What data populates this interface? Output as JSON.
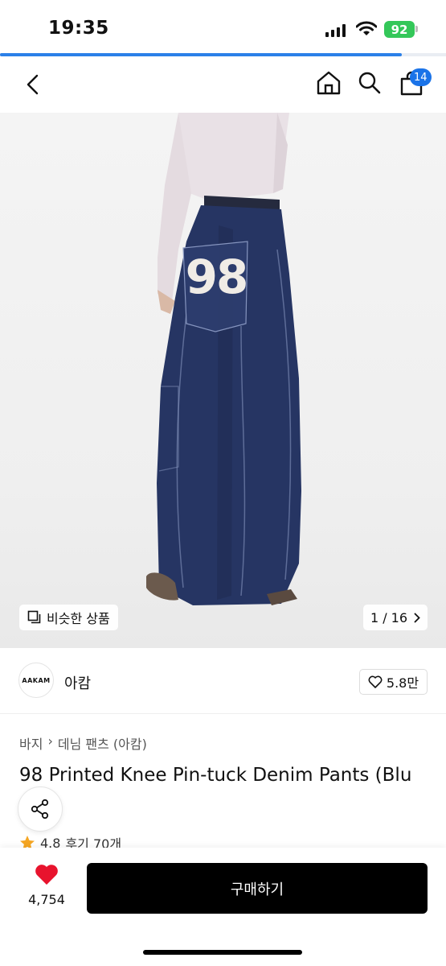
{
  "status_bar": {
    "time": "19:35",
    "battery": "92",
    "icons": [
      "signal-icon",
      "wifi-icon",
      "battery-icon"
    ],
    "battery_color": "#34c759"
  },
  "page_loading": {
    "progress_percent": 90,
    "color": "#2b80e8"
  },
  "nav": {
    "icons": [
      "chevron-left-icon",
      "home-icon",
      "search-icon",
      "shopping-bag-icon"
    ],
    "cart_badge": "14",
    "badge_color": "#1a73e8"
  },
  "hero": {
    "similar_label": "비슷한 상품",
    "similar_icon": "copy-icon",
    "page_indicator": "1 / 16",
    "pocket_print": "98"
  },
  "brand": {
    "logo_text": "AAKAM",
    "name": "아캄",
    "likes": "5.8만",
    "like_icon": "heart-outline-icon"
  },
  "product": {
    "breadcrumb": [
      "바지",
      "데님 팬츠 (아캄)"
    ],
    "title": "98 Printed Knee Pin-tuck Denim Pants (Blu",
    "rating": "4.8",
    "reviews": "후기 70개",
    "star_color": "#f5a623"
  },
  "bottom_bar": {
    "wish_count": "4,754",
    "wish_icon": "heart-filled-icon",
    "heart_color": "#e8132d",
    "buy_label": "구매하기"
  }
}
